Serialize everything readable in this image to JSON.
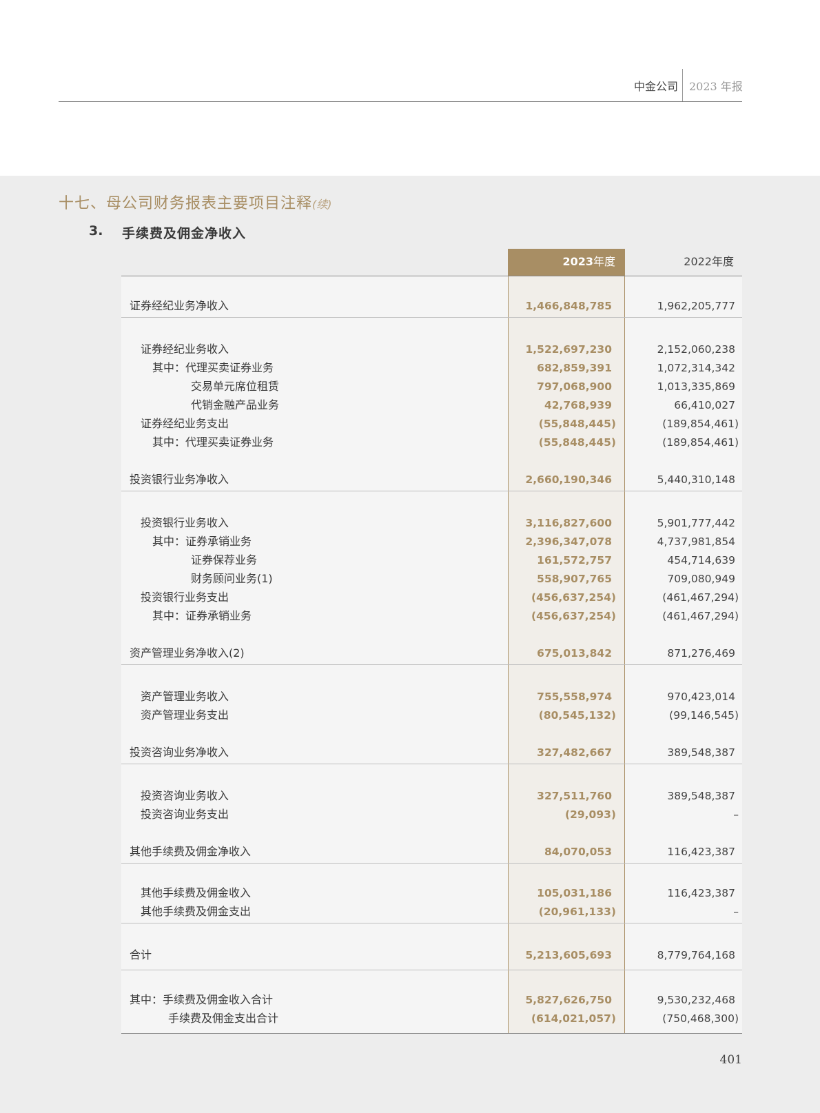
{
  "header": {
    "company": "中金公司",
    "report": "2023 年报"
  },
  "section": {
    "title": "十七、母公司财务报表主要项目注释",
    "continued": "(续)"
  },
  "subsection": {
    "number": "3.",
    "title": "手续费及佣金净收入"
  },
  "table": {
    "col_2023_year": "2023",
    "col_2023_suffix": "年度",
    "col_2022": "2022年度",
    "rows": [
      {
        "label": "证券经纪业务净收入",
        "v2023": "1,466,848,785",
        "v2022": "1,962,205,777"
      },
      {
        "label": "证券经纪业务收入",
        "v2023": "1,522,697,230",
        "v2022": "2,152,060,238"
      },
      {
        "label": "其中：代理买卖证券业务",
        "v2023": "682,859,391",
        "v2022": "1,072,314,342"
      },
      {
        "label": "交易单元席位租赁",
        "v2023": "797,068,900",
        "v2022": "1,013,335,869"
      },
      {
        "label": "代销金融产品业务",
        "v2023": "42,768,939",
        "v2022": "66,410,027"
      },
      {
        "label": "证券经纪业务支出",
        "v2023": "(55,848,445)",
        "v2022": "(189,854,461)"
      },
      {
        "label": "其中：代理买卖证券业务",
        "v2023": "(55,848,445)",
        "v2022": "(189,854,461)"
      },
      {
        "label": "投资银行业务净收入",
        "v2023": "2,660,190,346",
        "v2022": "5,440,310,148"
      },
      {
        "label": "投资银行业务收入",
        "v2023": "3,116,827,600",
        "v2022": "5,901,777,442"
      },
      {
        "label": "其中：证券承销业务",
        "v2023": "2,396,347,078",
        "v2022": "4,737,981,854"
      },
      {
        "label": "证券保荐业务",
        "v2023": "161,572,757",
        "v2022": "454,714,639"
      },
      {
        "label": "财务顾问业务(1)",
        "v2023": "558,907,765",
        "v2022": "709,080,949"
      },
      {
        "label": "投资银行业务支出",
        "v2023": "(456,637,254)",
        "v2022": "(461,467,294)"
      },
      {
        "label": "其中：证券承销业务",
        "v2023": "(456,637,254)",
        "v2022": "(461,467,294)"
      },
      {
        "label": "资产管理业务净收入(2)",
        "v2023": "675,013,842",
        "v2022": "871,276,469"
      },
      {
        "label": "资产管理业务收入",
        "v2023": "755,558,974",
        "v2022": "970,423,014"
      },
      {
        "label": "资产管理业务支出",
        "v2023": "(80,545,132)",
        "v2022": "(99,146,545)"
      },
      {
        "label": "投资咨询业务净收入",
        "v2023": "327,482,667",
        "v2022": "389,548,387"
      },
      {
        "label": "投资咨询业务收入",
        "v2023": "327,511,760",
        "v2022": "389,548,387"
      },
      {
        "label": "投资咨询业务支出",
        "v2023": "(29,093)",
        "v2022": "–"
      },
      {
        "label": "其他手续费及佣金净收入",
        "v2023": "84,070,053",
        "v2022": "116,423,387"
      },
      {
        "label": "其他手续费及佣金收入",
        "v2023": "105,031,186",
        "v2022": "116,423,387"
      },
      {
        "label": "其他手续费及佣金支出",
        "v2023": "(20,961,133)",
        "v2022": "–"
      },
      {
        "label": "合计",
        "v2023": "5,213,605,693",
        "v2022": "8,779,764,168"
      },
      {
        "label": "其中：手续费及佣金收入合计",
        "v2023": "5,827,626,750",
        "v2022": "9,530,232,468"
      },
      {
        "label": "手续费及佣金支出合计",
        "v2023": "(614,021,057)",
        "v2022": "(750,468,300)"
      }
    ]
  },
  "page_number": "401"
}
